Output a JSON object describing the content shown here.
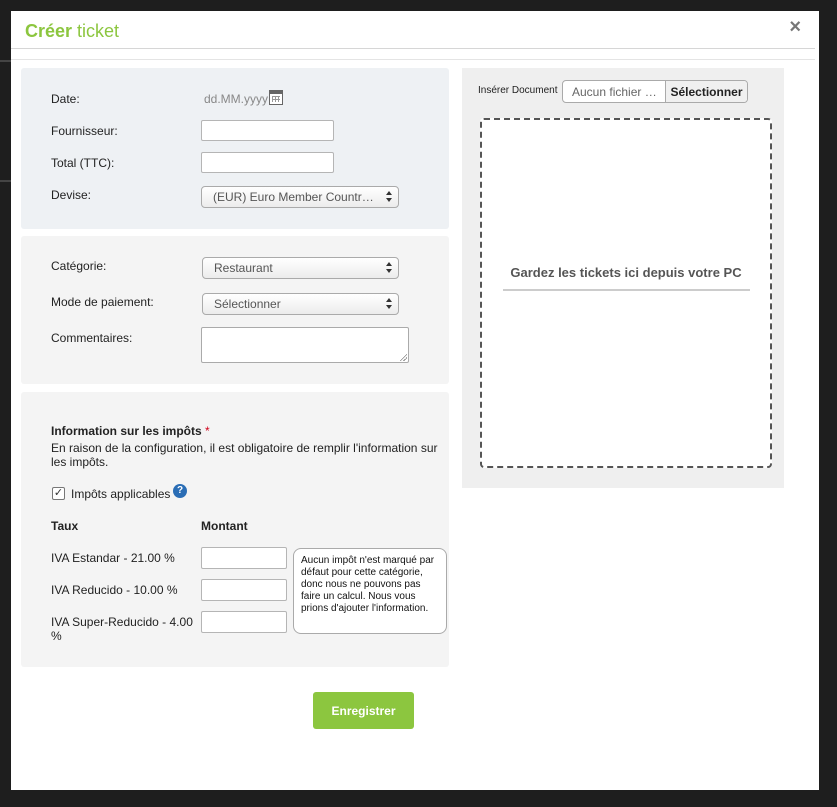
{
  "modal": {
    "title_bold": "Créer",
    "title_rest": " ticket",
    "close_glyph": "×"
  },
  "general": {
    "date_label": "Date:",
    "date_placeholder": "dd.MM.yyyy",
    "supplier_label": "Fournisseur:",
    "total_label": "Total (TTC):",
    "currency_label": "Devise:",
    "currency_value": "(EUR) Euro Member Countr…"
  },
  "details": {
    "category_label": "Catégorie:",
    "category_value": "Restaurant",
    "payment_label": "Mode de paiement:",
    "payment_value": "Sélectionner",
    "comments_label": "Commentaires:"
  },
  "taxes": {
    "title": "Information sur les impôts",
    "required_mark": "*",
    "description": "En raison de la configuration, il est obligatoire de remplir l'information sur les impôts.",
    "applicable_label": "Impôts applicables",
    "applicable_checked": "✓",
    "help_glyph": "?",
    "col_rate": "Taux",
    "col_amount": "Montant",
    "rates": [
      {
        "label": "IVA Estandar - 21.00 %"
      },
      {
        "label": "IVA Reducido - 10.00 %"
      },
      {
        "label": "IVA Super-Reducido - 4.00 %"
      }
    ],
    "note": "Aucun impôt n'est marqué par défaut pour cette catégorie, donc nous ne pouvons pas faire un calcul. Nous vous prions d'ajouter l'information."
  },
  "document": {
    "insert_label": "Insérer Document",
    "file_name": "Aucun fichier …",
    "select_button": "Sélectionner",
    "drop_text": "Gardez les tickets ici depuis votre PC"
  },
  "actions": {
    "save_label": "Enregistrer"
  },
  "colors": {
    "accent": "#8cc63f",
    "required": "#d0021b",
    "help": "#2a6db5"
  },
  "icons": [
    "calendar-icon",
    "close-icon",
    "help-icon",
    "select-arrows-icon",
    "checkmark-icon"
  ]
}
